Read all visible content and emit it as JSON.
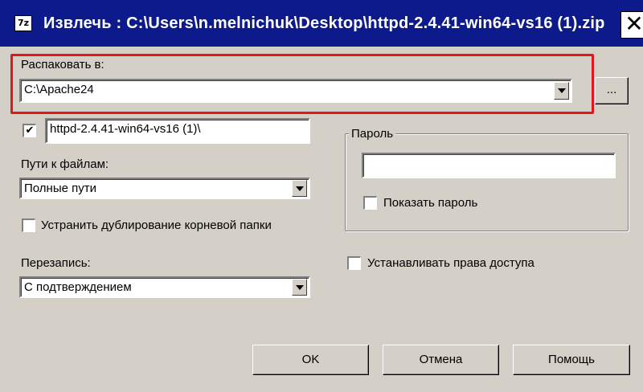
{
  "window": {
    "title": "Извлечь : C:\\Users\\n.melnichuk\\Desktop\\httpd-2.4.41-win64-vs16 (1).zip",
    "icon": "7z",
    "close_glyph": "✕"
  },
  "extract_to": {
    "label": "Распаковать в:",
    "value": "C:\\Apache24",
    "browse_label": "..."
  },
  "folder": {
    "checked": true,
    "check_glyph": "✔",
    "value": "httpd-2.4.41-win64-vs16 (1)\\"
  },
  "paths": {
    "label": "Пути к файлам:",
    "value": "Полные пути"
  },
  "eliminate_duplication": {
    "checked": false,
    "label": "Устранить дублирование корневой папки"
  },
  "overwrite": {
    "label": "Перезапись:",
    "value": "С подтверждением"
  },
  "password": {
    "group_label": "Пароль",
    "value": "",
    "show_label": "Показать пароль",
    "show_checked": false
  },
  "security": {
    "checked": false,
    "label": "Устанавливать права доступа"
  },
  "buttons": {
    "ok": "OK",
    "cancel": "Отмена",
    "help": "Помощь"
  },
  "colors": {
    "titlebar": "#0d1a8c",
    "dialog_bg": "#d4d0c8",
    "highlight": "#e8141c"
  }
}
